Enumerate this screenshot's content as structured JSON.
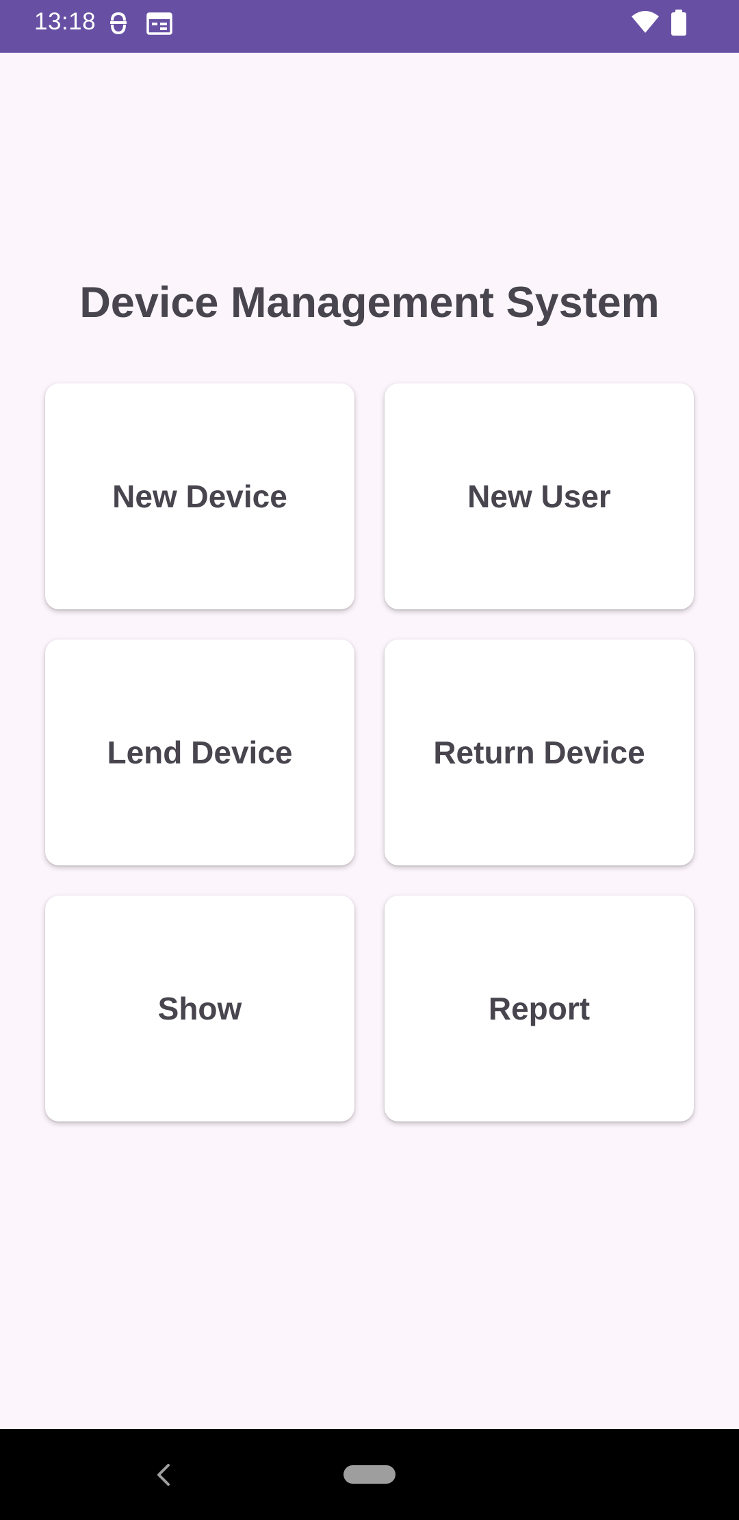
{
  "status_bar": {
    "time": "13:18",
    "icons": [
      "debug-icon",
      "calendar-icon",
      "wifi-icon",
      "battery-icon"
    ],
    "background": "#6750a4"
  },
  "main": {
    "title": "Device Management System",
    "buttons": [
      {
        "label": "New Device"
      },
      {
        "label": "New User"
      },
      {
        "label": "Lend Device"
      },
      {
        "label": "Return Device"
      },
      {
        "label": "Show"
      },
      {
        "label": "Report"
      }
    ]
  },
  "nav_bar": {
    "icons": [
      "back-icon",
      "home-pill-icon"
    ]
  },
  "colors": {
    "accent": "#6750a4",
    "background": "#fcf5fc",
    "card": "#ffffff",
    "text": "#48454e"
  }
}
